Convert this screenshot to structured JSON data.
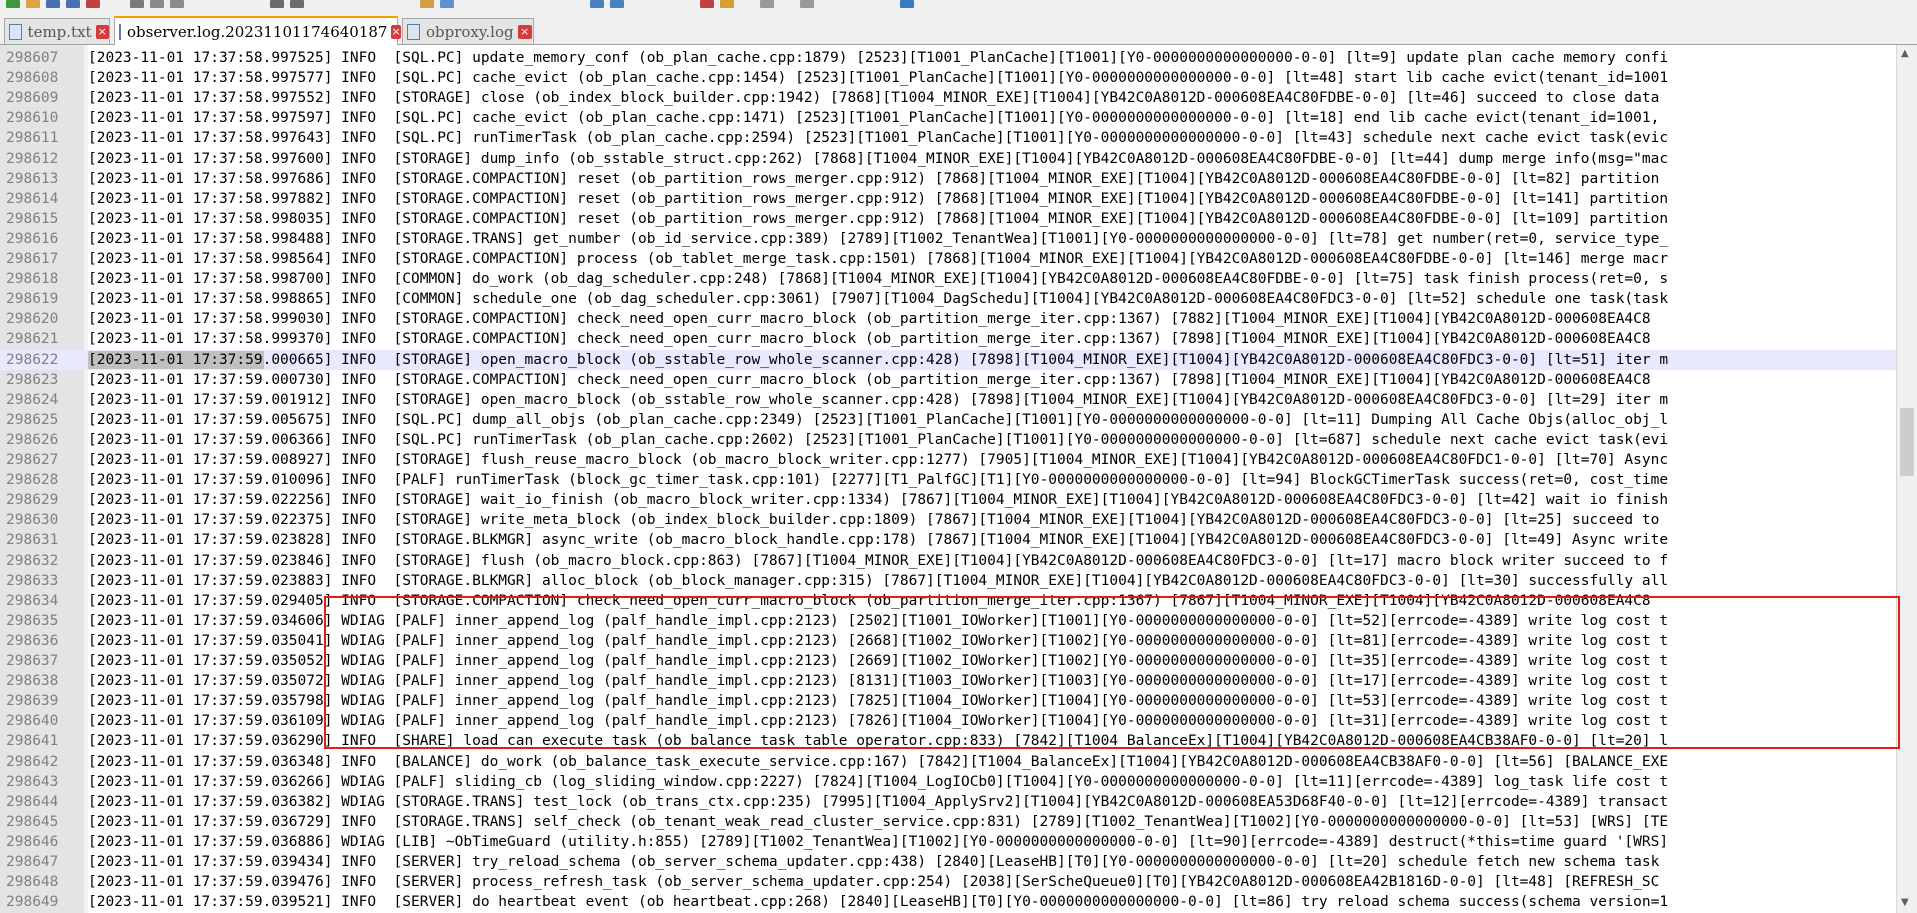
{
  "tabs": [
    {
      "label": "temp.txt",
      "active": false
    },
    {
      "label": "observer.log.20231101174640187",
      "active": true
    },
    {
      "label": "obproxy.log",
      "active": false
    }
  ],
  "colors": {
    "highlight_box": "#e31b1b",
    "current_line": "#e8e8ff",
    "active_tab_accent": "#f5a000"
  },
  "editor": {
    "current_line_number": "298622",
    "lines": [
      {
        "n": "298607",
        "t": "[2023-11-01 17:37:58.997525] INFO  [SQL.PC] update_memory_conf (ob_plan_cache.cpp:1879) [2523][T1001_PlanCache][T1001][Y0-0000000000000000-0-0] [lt=9] update plan cache memory confi"
      },
      {
        "n": "298608",
        "t": "[2023-11-01 17:37:58.997577] INFO  [SQL.PC] cache_evict (ob_plan_cache.cpp:1454) [2523][T1001_PlanCache][T1001][Y0-0000000000000000-0-0] [lt=48] start lib cache evict(tenant_id=1001"
      },
      {
        "n": "298609",
        "t": "[2023-11-01 17:37:58.997552] INFO  [STORAGE] close (ob_index_block_builder.cpp:1942) [7868][T1004_MINOR_EXE][T1004][YB42C0A8012D-000608EA4C80FDBE-0-0] [lt=46] succeed to close data"
      },
      {
        "n": "298610",
        "t": "[2023-11-01 17:37:58.997597] INFO  [SQL.PC] cache_evict (ob_plan_cache.cpp:1471) [2523][T1001_PlanCache][T1001][Y0-0000000000000000-0-0] [lt=18] end lib cache evict(tenant_id=1001,"
      },
      {
        "n": "298611",
        "t": "[2023-11-01 17:37:58.997643] INFO  [SQL.PC] runTimerTask (ob_plan_cache.cpp:2594) [2523][T1001_PlanCache][T1001][Y0-0000000000000000-0-0] [lt=43] schedule next cache evict task(evic"
      },
      {
        "n": "298612",
        "t": "[2023-11-01 17:37:58.997600] INFO  [STORAGE] dump_info (ob_sstable_struct.cpp:262) [7868][T1004_MINOR_EXE][T1004][YB42C0A8012D-000608EA4C80FDBE-0-0] [lt=44] dump merge info(msg=\"mac"
      },
      {
        "n": "298613",
        "t": "[2023-11-01 17:37:58.997686] INFO  [STORAGE.COMPACTION] reset (ob_partition_rows_merger.cpp:912) [7868][T1004_MINOR_EXE][T1004][YB42C0A8012D-000608EA4C80FDBE-0-0] [lt=82] partition"
      },
      {
        "n": "298614",
        "t": "[2023-11-01 17:37:58.997882] INFO  [STORAGE.COMPACTION] reset (ob_partition_rows_merger.cpp:912) [7868][T1004_MINOR_EXE][T1004][YB42C0A8012D-000608EA4C80FDBE-0-0] [lt=141] partition"
      },
      {
        "n": "298615",
        "t": "[2023-11-01 17:37:58.998035] INFO  [STORAGE.COMPACTION] reset (ob_partition_rows_merger.cpp:912) [7868][T1004_MINOR_EXE][T1004][YB42C0A8012D-000608EA4C80FDBE-0-0] [lt=109] partition"
      },
      {
        "n": "298616",
        "t": "[2023-11-01 17:37:58.998488] INFO  [STORAGE.TRANS] get_number (ob_id_service.cpp:389) [2789][T1002_TenantWea][T1001][Y0-0000000000000000-0-0] [lt=78] get number(ret=0, service_type_"
      },
      {
        "n": "298617",
        "t": "[2023-11-01 17:37:58.998564] INFO  [STORAGE.COMPACTION] process (ob_tablet_merge_task.cpp:1501) [7868][T1004_MINOR_EXE][T1004][YB42C0A8012D-000608EA4C80FDBE-0-0] [lt=146] merge macr"
      },
      {
        "n": "298618",
        "t": "[2023-11-01 17:37:58.998700] INFO  [COMMON] do_work (ob_dag_scheduler.cpp:248) [7868][T1004_MINOR_EXE][T1004][YB42C0A8012D-000608EA4C80FDBE-0-0] [lt=75] task finish process(ret=0, s"
      },
      {
        "n": "298619",
        "t": "[2023-11-01 17:37:58.998865] INFO  [COMMON] schedule_one (ob_dag_scheduler.cpp:3061) [7907][T1004_DagSchedu][T1004][YB42C0A8012D-000608EA4C80FDC3-0-0] [lt=52] schedule one task(task"
      },
      {
        "n": "298620",
        "t": "[2023-11-01 17:37:58.999030] INFO  [STORAGE.COMPACTION] check_need_open_curr_macro_block (ob_partition_merge_iter.cpp:1367) [7882][T1004_MINOR_EXE][T1004][YB42C0A8012D-000608EA4C8"
      },
      {
        "n": "298621",
        "t": "[2023-11-01 17:37:58.999370] INFO  [STORAGE.COMPACTION] check_need_open_curr_macro_block (ob_partition_merge_iter.cpp:1367) [7898][T1004_MINOR_EXE][T1004][YB42C0A8012D-000608EA4C8"
      },
      {
        "n": "298622",
        "t": "[2023-11-01 17:37:59.000665] INFO  [STORAGE] open_macro_block (ob_sstable_row_whole_scanner.cpp:428) [7898][T1004_MINOR_EXE][T1004][YB42C0A8012D-000608EA4C80FDC3-0-0] [lt=51] iter m"
      },
      {
        "n": "298623",
        "t": "[2023-11-01 17:37:59.000730] INFO  [STORAGE.COMPACTION] check_need_open_curr_macro_block (ob_partition_merge_iter.cpp:1367) [7898][T1004_MINOR_EXE][T1004][YB42C0A8012D-000608EA4C8"
      },
      {
        "n": "298624",
        "t": "[2023-11-01 17:37:59.001912] INFO  [STORAGE] open_macro_block (ob_sstable_row_whole_scanner.cpp:428) [7898][T1004_MINOR_EXE][T1004][YB42C0A8012D-000608EA4C80FDC3-0-0] [lt=29] iter m"
      },
      {
        "n": "298625",
        "t": "[2023-11-01 17:37:59.005675] INFO  [SQL.PC] dump_all_objs (ob_plan_cache.cpp:2349) [2523][T1001_PlanCache][T1001][Y0-0000000000000000-0-0] [lt=11] Dumping All Cache Objs(alloc_obj_l"
      },
      {
        "n": "298626",
        "t": "[2023-11-01 17:37:59.006366] INFO  [SQL.PC] runTimerTask (ob_plan_cache.cpp:2602) [2523][T1001_PlanCache][T1001][Y0-0000000000000000-0-0] [lt=687] schedule next cache evict task(evi"
      },
      {
        "n": "298627",
        "t": "[2023-11-01 17:37:59.008927] INFO  [STORAGE] flush_reuse_macro_block (ob_macro_block_writer.cpp:1277) [7905][T1004_MINOR_EXE][T1004][YB42C0A8012D-000608EA4C80FDC1-0-0] [lt=70] Async"
      },
      {
        "n": "298628",
        "t": "[2023-11-01 17:37:59.010096] INFO  [PALF] runTimerTask (block_gc_timer_task.cpp:101) [2277][T1_PalfGC][T1][Y0-0000000000000000-0-0] [lt=94] BlockGCTimerTask success(ret=0, cost_time"
      },
      {
        "n": "298629",
        "t": "[2023-11-01 17:37:59.022256] INFO  [STORAGE] wait_io_finish (ob_macro_block_writer.cpp:1334) [7867][T1004_MINOR_EXE][T1004][YB42C0A8012D-000608EA4C80FDC3-0-0] [lt=42] wait io finish"
      },
      {
        "n": "298630",
        "t": "[2023-11-01 17:37:59.022375] INFO  [STORAGE] write_meta_block (ob_index_block_builder.cpp:1809) [7867][T1004_MINOR_EXE][T1004][YB42C0A8012D-000608EA4C80FDC3-0-0] [lt=25] succeed to"
      },
      {
        "n": "298631",
        "t": "[2023-11-01 17:37:59.023828] INFO  [STORAGE.BLKMGR] async_write (ob_macro_block_handle.cpp:178) [7867][T1004_MINOR_EXE][T1004][YB42C0A8012D-000608EA4C80FDC3-0-0] [lt=49] Async write"
      },
      {
        "n": "298632",
        "t": "[2023-11-01 17:37:59.023846] INFO  [STORAGE] flush (ob_macro_block.cpp:863) [7867][T1004_MINOR_EXE][T1004][YB42C0A8012D-000608EA4C80FDC3-0-0] [lt=17] macro block writer succeed to f"
      },
      {
        "n": "298633",
        "t": "[2023-11-01 17:37:59.023883] INFO  [STORAGE.BLKMGR] alloc_block (ob_block_manager.cpp:315) [7867][T1004_MINOR_EXE][T1004][YB42C0A8012D-000608EA4C80FDC3-0-0] [lt=30] successfully all"
      },
      {
        "n": "298634",
        "t": "[2023-11-01 17:37:59.029405] INFO  [STORAGE.COMPACTION] check_need_open_curr_macro_block (ob_partition_merge_iter.cpp:1367) [7867][T1004_MINOR_EXE][T1004][YB42C0A8012D-000608EA4C8"
      },
      {
        "n": "298635",
        "t": "[2023-11-01 17:37:59.034606] WDIAG [PALF] inner_append_log (palf_handle_impl.cpp:2123) [2502][T1001_IOWorker][T1001][Y0-0000000000000000-0-0] [lt=52][errcode=-4389] write log cost t"
      },
      {
        "n": "298636",
        "t": "[2023-11-01 17:37:59.035041] WDIAG [PALF] inner_append_log (palf_handle_impl.cpp:2123) [2668][T1002_IOWorker][T1002][Y0-0000000000000000-0-0] [lt=81][errcode=-4389] write log cost t"
      },
      {
        "n": "298637",
        "t": "[2023-11-01 17:37:59.035052] WDIAG [PALF] inner_append_log (palf_handle_impl.cpp:2123) [2669][T1002_IOWorker][T1002][Y0-0000000000000000-0-0] [lt=35][errcode=-4389] write log cost t"
      },
      {
        "n": "298638",
        "t": "[2023-11-01 17:37:59.035072] WDIAG [PALF] inner_append_log (palf_handle_impl.cpp:2123) [8131][T1003_IOWorker][T1003][Y0-0000000000000000-0-0] [lt=17][errcode=-4389] write log cost t"
      },
      {
        "n": "298639",
        "t": "[2023-11-01 17:37:59.035798] WDIAG [PALF] inner_append_log (palf_handle_impl.cpp:2123) [7825][T1004_IOWorker][T1004][Y0-0000000000000000-0-0] [lt=53][errcode=-4389] write log cost t"
      },
      {
        "n": "298640",
        "t": "[2023-11-01 17:37:59.036109] WDIAG [PALF] inner_append_log (palf_handle_impl.cpp:2123) [7826][T1004_IOWorker][T1004][Y0-0000000000000000-0-0] [lt=31][errcode=-4389] write log cost t"
      },
      {
        "n": "298641",
        "t": "[2023-11-01 17:37:59.036290] INFO  [SHARE] load_can_execute_task (ob_balance_task_table_operator.cpp:833) [7842][T1004_BalanceEx][T1004][YB42C0A8012D-000608EA4CB38AF0-0-0] [lt=20] l"
      },
      {
        "n": "298642",
        "t": "[2023-11-01 17:37:59.036348] INFO  [BALANCE] do_work (ob_balance_task_execute_service.cpp:167) [7842][T1004_BalanceEx][T1004][YB42C0A8012D-000608EA4CB38AF0-0-0] [lt=56] [BALANCE_EXE"
      },
      {
        "n": "298643",
        "t": "[2023-11-01 17:37:59.036266] WDIAG [PALF] sliding_cb (log_sliding_window.cpp:2227) [7824][T1004_LogIOCb0][T1004][Y0-0000000000000000-0-0] [lt=11][errcode=-4389] log_task life cost t"
      },
      {
        "n": "298644",
        "t": "[2023-11-01 17:37:59.036382] WDIAG [STORAGE.TRANS] test_lock (ob_trans_ctx.cpp:235) [7995][T1004_ApplySrv2][T1004][YB42C0A8012D-000608EA53D68F40-0-0] [lt=12][errcode=-4389] transact"
      },
      {
        "n": "298645",
        "t": "[2023-11-01 17:37:59.036729] INFO  [STORAGE.TRANS] self_check (ob_tenant_weak_read_cluster_service.cpp:831) [2789][T1002_TenantWea][T1002][Y0-0000000000000000-0-0] [lt=53] [WRS] [TE"
      },
      {
        "n": "298646",
        "t": "[2023-11-01 17:37:59.036886] WDIAG [LIB] ~ObTimeGuard (utility.h:855) [2789][T1002_TenantWea][T1002][Y0-0000000000000000-0-0] [lt=90][errcode=-4389] destruct(*this=time guard '[WRS]"
      },
      {
        "n": "298647",
        "t": "[2023-11-01 17:37:59.039434] INFO  [SERVER] try_reload_schema (ob_server_schema_updater.cpp:438) [2840][LeaseHB][T0][Y0-0000000000000000-0-0] [lt=20] schedule fetch new schema task"
      },
      {
        "n": "298648",
        "t": "[2023-11-01 17:37:59.039476] INFO  [SERVER] process_refresh_task (ob_server_schema_updater.cpp:254) [2038][SerScheQueue0][T0][YB42C0A8012D-000608EA42B1816D-0-0] [lt=48] [REFRESH_SC"
      },
      {
        "n": "298649",
        "t": "[2023-11-01 17:37:59.039521] INFO  [SERVER] do heartbeat event (ob heartbeat.cpp:268) [2840][LeaseHB][T0][Y0-0000000000000000-0-0] [lt=86] try reload schema success(schema version=1"
      }
    ]
  }
}
